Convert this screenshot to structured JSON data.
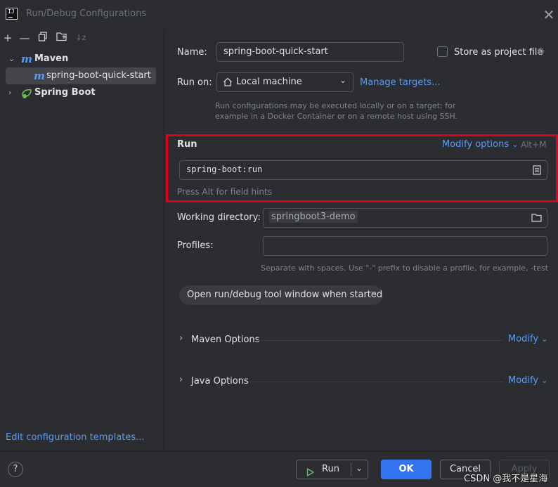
{
  "window": {
    "title": "Run/Debug Configurations",
    "logo_text": "IJ"
  },
  "toolbar": {
    "icons": [
      "add-icon",
      "remove-icon",
      "copy-icon",
      "new-folder-icon",
      "sort-icon"
    ],
    "add": "+",
    "remove": "—",
    "sort": "↓z"
  },
  "tree": {
    "maven_label": "Maven",
    "maven_icon_glyph": "m",
    "child_label": "spring-boot-quick-start",
    "springboot_label": "Spring Boot"
  },
  "left_footer": {
    "edit_templates": "Edit configuration templates..."
  },
  "form": {
    "name_label": "Name:",
    "name_value": "spring-boot-quick-start",
    "store_label": "Store as project file",
    "run_on_label": "Run on:",
    "run_on_value": "Local machine",
    "manage_targets": "Manage targets...",
    "run_on_hint_1": "Run configurations may be executed locally or on a target: for",
    "run_on_hint_2": "example in a Docker Container or on a remote host using SSH.",
    "run_section": "Run",
    "modify_options": "Modify options",
    "modify_shortcut": "Alt+M",
    "run_command": "spring-boot:run",
    "field_hint": "Press Alt for field hints",
    "workdir_label": "Working directory:",
    "workdir_value": "springboot3-demo",
    "profiles_label": "Profiles:",
    "profiles_value": "",
    "profiles_hint": "Separate with spaces. Use \"-\" prefix to disable a profile, for example, -test",
    "chip_label": "Open run/debug tool window when started",
    "maven_options": "Maven Options",
    "java_options": "Java Options",
    "modify": "Modify"
  },
  "buttons": {
    "help": "?",
    "run": "Run",
    "ok": "OK",
    "cancel": "Cancel",
    "apply": "Apply"
  },
  "watermark": "CSDN @我不是星海",
  "colors": {
    "background": "#2b2d30",
    "accent": "#5a9cf5",
    "primary_button": "#3574f0",
    "highlight": "#e0001b",
    "run_icon": "#5fb865",
    "springboot_icon": "#6ebd52"
  }
}
